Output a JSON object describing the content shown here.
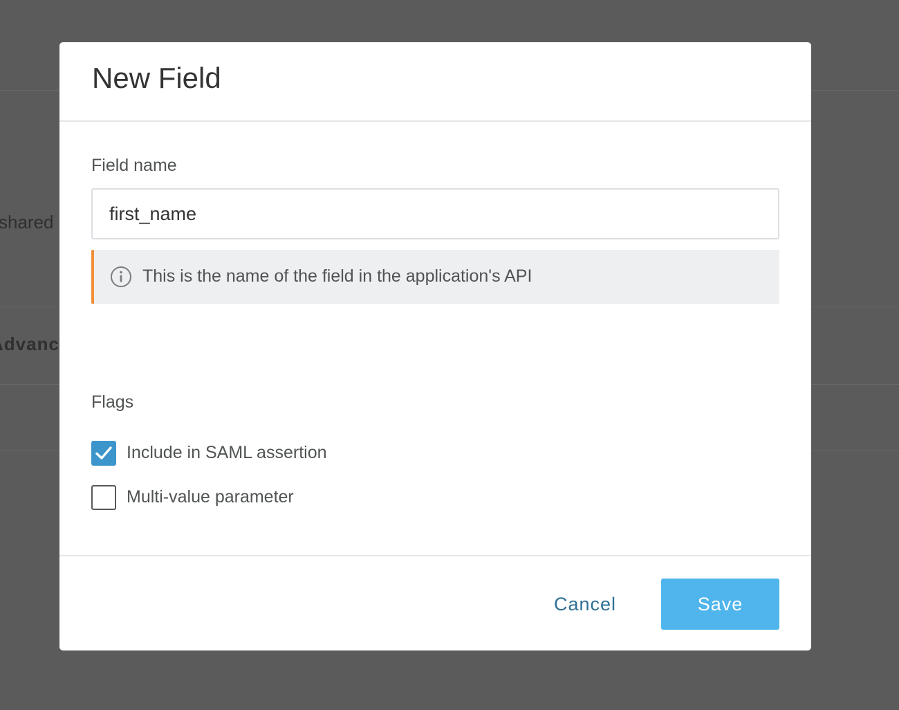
{
  "background": {
    "partial_text_1": "shared",
    "partial_text_2": "Advanced"
  },
  "modal": {
    "title": "New Field",
    "field_name": {
      "label": "Field name",
      "value": "first_name",
      "hint": "This is the name of the field in the application's API",
      "hint_icon": "info-circle-icon"
    },
    "flags": {
      "label": "Flags",
      "items": [
        {
          "label": "Include in SAML assertion",
          "checked": true
        },
        {
          "label": "Multi-value parameter",
          "checked": false
        }
      ]
    },
    "footer": {
      "cancel_label": "Cancel",
      "save_label": "Save"
    }
  },
  "colors": {
    "accent": "#3c95cb",
    "save_button": "#4fb5ec",
    "cancel_text": "#2f6f96",
    "hint_border": "#f0903a",
    "overlay": "#5a5b5a"
  }
}
